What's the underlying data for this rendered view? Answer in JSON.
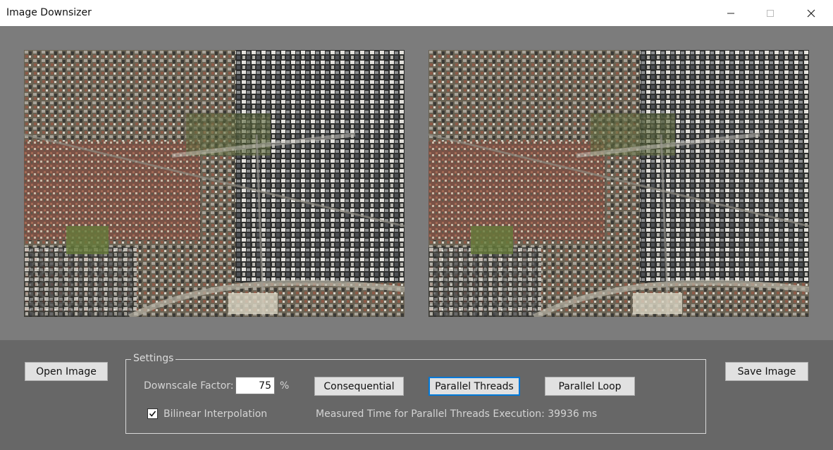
{
  "window": {
    "title": "Image Downsizer",
    "controls": [
      "minimize-icon",
      "maximize-icon",
      "close-icon"
    ]
  },
  "images": {
    "original_alt": "aerial-city-image",
    "result_alt": "aerial-city-image"
  },
  "toolbar": {
    "open_label": "Open Image",
    "save_label": "Save Image"
  },
  "settings": {
    "group_label": "Settings",
    "factor_label": "Downscale Factor:",
    "factor_value": "75",
    "factor_unit": "%",
    "bilinear_label": "Bilinear Interpolation",
    "bilinear_checked": true,
    "buttons": {
      "consequential": "Consequential",
      "parallel_threads": "Parallel Threads",
      "parallel_loop": "Parallel Loop"
    },
    "focused_button": "parallel_threads",
    "status_text": "Measured Time for Parallel Threads Execution: 39936 ms"
  },
  "colors": {
    "panel_bg": "#676767",
    "image_area_bg": "#7c7c7c",
    "focus_accent": "#0078d7"
  }
}
